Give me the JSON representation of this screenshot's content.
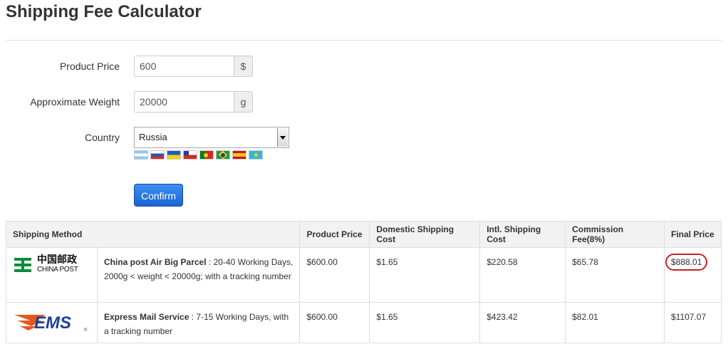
{
  "title": "Shipping Fee Calculator",
  "form": {
    "price_label": "Product Price",
    "price_value": "600",
    "price_addon": "$",
    "weight_label": "Approximate Weight",
    "weight_value": "20000",
    "weight_addon": "g",
    "country_label": "Country",
    "country_value": "Russia",
    "flags": [
      "argentina-flag",
      "russia-flag",
      "ukraine-flag",
      "chile-flag",
      "portugal-flag",
      "brazil-flag",
      "spain-flag",
      "kazakhstan-flag"
    ],
    "confirm_label": "Confirm"
  },
  "table": {
    "headers": [
      "Shipping Method",
      "Product Price",
      "Domestic Shipping Cost",
      "Intl. Shipping Cost",
      "Commission Fee(8%)",
      "Final Price"
    ],
    "rows": [
      {
        "logo": "china-post-logo",
        "logo_text_cn": "中国邮政",
        "logo_text_en": "CHINA POST",
        "method_name": "China post Air Big Parcel",
        "method_desc": " : 20-40 Working Days, 2000g < weight < 20000g; with a tracking number",
        "product_price": "$600.00",
        "domestic": "$1.65",
        "intl": "$220.58",
        "commission": "$65.78",
        "final": "$888.01"
      },
      {
        "logo": "ems-logo",
        "logo_text_en": "EMS",
        "method_name": "Express Mail Service",
        "method_desc": " : 7-15 Working Days, with a tracking number",
        "product_price": "$600.00",
        "domestic": "$1.65",
        "intl": "$423.42",
        "commission": "$82.01",
        "final": "$1107.07"
      }
    ]
  },
  "colors": {
    "accent": "#1f6fe0",
    "highlight": "#cc1f1f",
    "china_post_green": "#0a8c3c",
    "ems_orange": "#e8561e",
    "ems_blue": "#1f3f99"
  }
}
